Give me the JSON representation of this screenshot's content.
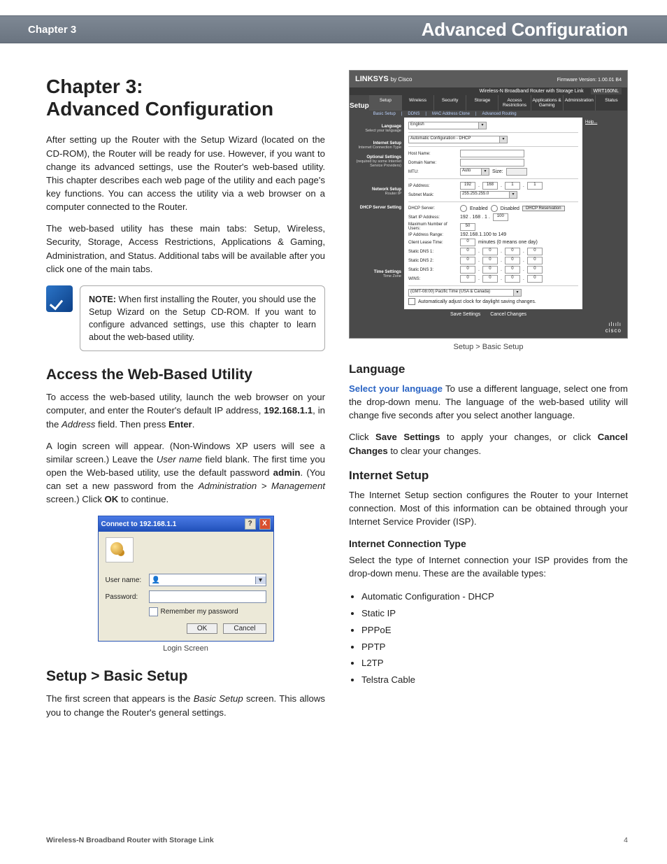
{
  "header": {
    "chapter_label": "Chapter 3",
    "section_name": "Advanced Configuration"
  },
  "col_left": {
    "title_line1": "Chapter 3:",
    "title_line2": "Advanced Configuration",
    "intro_p1": "After setting up the Router with the Setup Wizard (located on the CD-ROM), the Router will be ready for use. However, if you want to change its advanced settings, use the Router's web-based utility. This chapter describes each web page of the utility and each page's key functions. You can access the utility via a web browser on a computer connected to the Router.",
    "intro_p2": "The web-based utility has these main tabs: Setup, Wireless, Security, Storage, Access Restrictions, Applications & Gaming, Administration, and Status. Additional tabs will be available after you click one of the main tabs.",
    "note_label": "NOTE:",
    "note_text": " When first installing the Router, you should use the Setup Wizard on the Setup CD-ROM. If you want to configure advanced settings, use this chapter to learn about the web-based utility.",
    "h2_access": "Access the Web-Based Utility",
    "access_p1_a": "To access the web-based utility, launch the web browser on your computer, and enter the Router's default IP address, ",
    "access_p1_ip": "192.168.1.1",
    "access_p1_b": ", in the ",
    "access_p1_addr": "Address",
    "access_p1_c": " field. Then press ",
    "access_p1_enter": "Enter",
    "access_p1_d": ".",
    "access_p2_a": "A login screen will appear. (Non-Windows XP users will see a similar screen.) Leave the ",
    "access_p2_user": "User name",
    "access_p2_b": " field blank. The first time you open the Web-based utility, use the default password ",
    "access_p2_admin": "admin",
    "access_p2_c": ". (You can set a new password from the ",
    "access_p2_path": "Administration > Management",
    "access_p2_d": " screen.) Click ",
    "access_p2_ok": "OK",
    "access_p2_e": " to continue.",
    "login": {
      "title": "Connect to 192.168.1.1",
      "help": "?",
      "close": "X",
      "user_label": "User name:",
      "pass_label": "Password:",
      "user_icon": "👤",
      "remember": "Remember my password",
      "ok": "OK",
      "cancel": "Cancel",
      "caption": "Login Screen"
    },
    "h2_basic": "Setup > Basic Setup",
    "basic_p1_a": "The first screen that appears is the ",
    "basic_p1_i": "Basic Setup",
    "basic_p1_b": " screen. This allows you to change the Router's general settings."
  },
  "col_right": {
    "router_ui": {
      "brand": "LINKSYS",
      "by": "by Cisco",
      "fw": "Firmware Version: 1.00.01 B4",
      "product": "Wireless-N Broadband Router with Storage Link",
      "model": "WRT160NL",
      "active_tab": "Setup",
      "tabs": [
        "Setup",
        "Wireless",
        "Security",
        "Storage",
        "Access Restrictions",
        "Applications & Gaming",
        "Administration",
        "Status"
      ],
      "subtabs": [
        "Basic Setup",
        "DDNS",
        "MAC Address Clone",
        "Advanced Routing"
      ],
      "lang_hdr": "Language",
      "lang_sub": "Select your language",
      "lang_val": "English",
      "help": "Help...",
      "inet_hdr": "Internet Setup",
      "inet_sub": "Internet Connection Type",
      "inet_val": "Automatic Configuration - DHCP",
      "opt_hdr": "Optional Settings",
      "opt_sub": "(required by some Internet Service Providers)",
      "host": "Host Name:",
      "domain": "Domain Name:",
      "mtu": "MTU:",
      "mtu_mode": "Auto",
      "mtu_size": "Size:",
      "net_hdr": "Network Setup",
      "net_sub": "Router IP",
      "ip_lbl": "IP Address:",
      "ip": [
        "192",
        "168",
        "1",
        "1"
      ],
      "mask_lbl": "Subnet Mask:",
      "mask": "255.255.255.0",
      "dhcp_hdr": "DHCP Server Setting",
      "dhcp_srv": "DHCP Server:",
      "enabled": "Enabled",
      "disabled": "Disabled",
      "dhcp_res": "DHCP Reservation",
      "start_ip": "Start IP Address:",
      "start_ip_pre": "192 . 168 . 1 .",
      "start_ip_v": "100",
      "max_users": "Maximum Number of Users:",
      "max_users_v": "50",
      "ip_range": "IP Address Range:",
      "ip_range_v": "192.168.1.100 to 149",
      "lease": "Client Lease Time:",
      "lease_v": "0",
      "lease_unit": "minutes (0 means one day)",
      "dns1": "Static DNS 1:",
      "dns2": "Static DNS 2:",
      "dns3": "Static DNS 3:",
      "wins": "WINS:",
      "zeros": [
        "0",
        "0",
        "0",
        "0"
      ],
      "time_hdr": "Time Settings",
      "time_sub": "Time Zone",
      "tz": "(GMT-08:00) Pacific Time (USA & Canada)",
      "auto_dst": "Automatically adjust clock for daylight saving changes.",
      "save": "Save Settings",
      "cancel": "Cancel Changes",
      "cisco": "cisco"
    },
    "caption_basic": "Setup > Basic Setup",
    "h3_lang": "Language",
    "lang_accent": "Select your language",
    "lang_p": "  To use a different language, select one from the drop-down menu. The language of the web-based utility will change five seconds after you select another language.",
    "save_p_a": "Click ",
    "save_p_save": "Save Settings",
    "save_p_b": " to apply your changes, or click ",
    "save_p_cancel": "Cancel Changes",
    "save_p_c": " to clear your changes.",
    "h3_inet": "Internet Setup",
    "inet_p": "The Internet Setup section configures the Router to your Internet connection. Most of this information can be obtained through your Internet Service Provider (ISP).",
    "h4_ict": "Internet Connection Type",
    "ict_p": "Select the type of Internet connection your ISP provides from the drop-down menu. These are the available types:",
    "ict_list": [
      "Automatic Configuration - DHCP",
      "Static IP",
      "PPPoE",
      "PPTP",
      "L2TP",
      "Telstra Cable"
    ]
  },
  "footer": {
    "title": "Wireless-N Broadband Router with Storage Link",
    "page": "4"
  }
}
